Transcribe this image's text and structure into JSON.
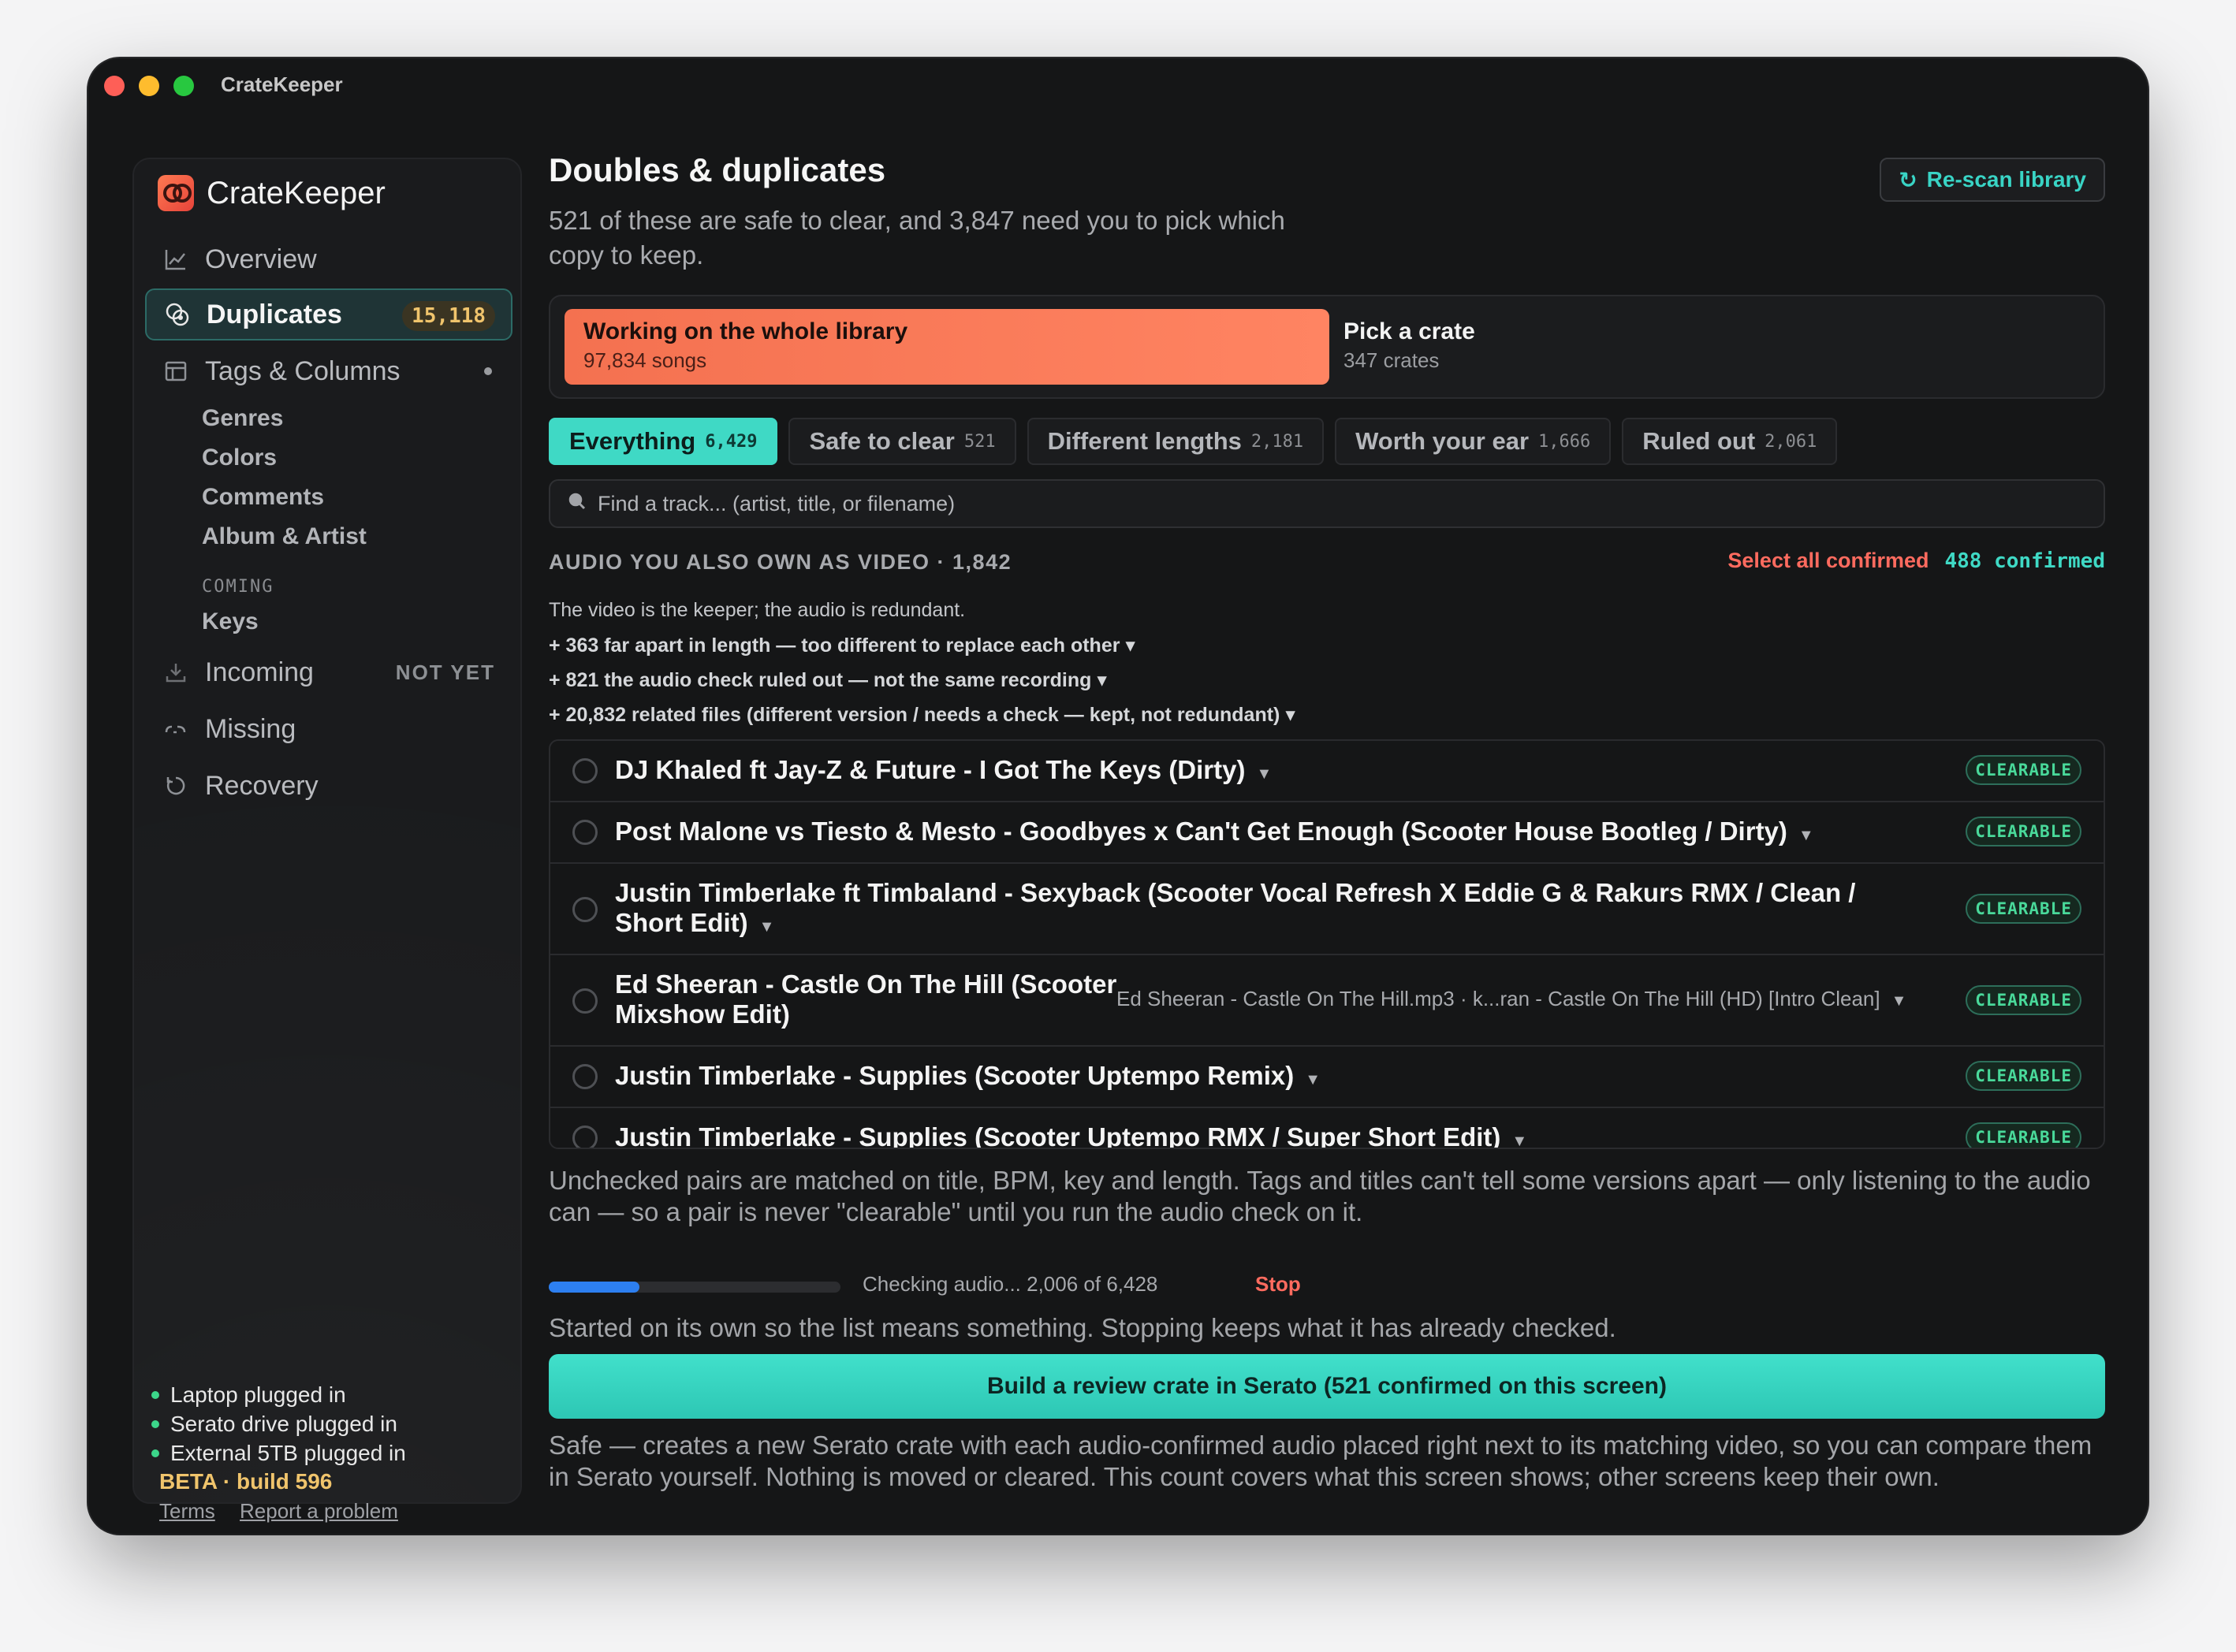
{
  "window": {
    "title": "CrateKeeper"
  },
  "sidebar": {
    "brand": "CrateKeeper",
    "items": [
      {
        "label": "Overview",
        "icon": "chart-icon"
      },
      {
        "label": "Duplicates",
        "icon": "duplicates-icon",
        "badge": "15,118",
        "active": true
      },
      {
        "label": "Tags & Columns",
        "icon": "table-icon"
      },
      {
        "label": "Incoming",
        "icon": "download-icon",
        "note": "NOT YET"
      },
      {
        "label": "Missing",
        "icon": "link-broken-icon"
      },
      {
        "label": "Recovery",
        "icon": "undo-icon"
      }
    ],
    "sub_items": [
      "Genres",
      "Colors",
      "Comments",
      "Album & Artist"
    ],
    "coming_label": "COMING",
    "coming_item": "Keys",
    "status": [
      "Laptop plugged in",
      "Serato drive plugged in",
      "External 5TB plugged in"
    ],
    "beta": "BETA · build 596",
    "links": [
      "Terms",
      "Report a problem"
    ]
  },
  "main": {
    "title": "Doubles & duplicates",
    "subtitle": "521 of these are safe to clear, and 3,847 need you to pick which copy to keep.",
    "rescan_label": "Re-scan library",
    "scope": {
      "whole_title": "Working on the whole library",
      "whole_sub": "97,834 songs",
      "crate_title": "Pick a crate",
      "crate_sub": "347 crates"
    },
    "tabs": [
      {
        "label": "Everything",
        "count": "6,429",
        "active": true
      },
      {
        "label": "Safe to clear",
        "count": "521"
      },
      {
        "label": "Different lengths",
        "count": "2,181"
      },
      {
        "label": "Worth your ear",
        "count": "1,666"
      },
      {
        "label": "Ruled out",
        "count": "2,061"
      }
    ],
    "search_placeholder": "Find a track... (artist, title, or filename)",
    "section": {
      "title": "AUDIO YOU ALSO OWN AS VIDEO · 1,842",
      "select_all": "Select all confirmed",
      "confirmed": "488 confirmed",
      "note": "The video is the keeper; the audio is redundant.",
      "expanders": [
        "+ 363 far apart in length — too different to replace each other",
        "+ 821 the audio check ruled out — not the same recording",
        "+ 20,832 related files (different version / needs a check — kept, not redundant)"
      ]
    },
    "rows": [
      {
        "title": "DJ Khaled ft Jay-Z & Future - I Got The Keys (Dirty)",
        "badge": "CLEARABLE"
      },
      {
        "title": "Post Malone vs Tiesto & Mesto - Goodbyes x Can't Get Enough (Scooter House Bootleg / Dirty)",
        "badge": "CLEARABLE"
      },
      {
        "title": "Justin Timberlake ft Timbaland - Sexyback (Scooter Vocal Refresh X Eddie G & Rakurs RMX / Clean / Short Edit)",
        "badge": "CLEARABLE"
      },
      {
        "title": "Ed Sheeran - Castle On The Hill (Scooter Mixshow Edit)",
        "files": "Ed Sheeran - Castle On The Hill.mp3  ·  k...ran - Castle On The Hill (HD) [Intro Clean]",
        "badge": "CLEARABLE"
      },
      {
        "title": "Justin Timberlake - Supplies (Scooter Uptempo Remix)",
        "badge": "CLEARABLE"
      },
      {
        "title": "Justin Timberlake - Supplies (Scooter Uptempo RMX / Super Short Edit)",
        "badge": "CLEARABLE"
      }
    ],
    "explain": "Unchecked pairs are matched on title, BPM, key and length. Tags and titles can't tell some versions apart — only listening to the audio can — so a pair is never \"clearable\" until you run the audio check on it.",
    "progress": {
      "text": "Checking audio... 2,006 of 6,428",
      "stop": "Stop",
      "fraction": 0.312
    },
    "started": "Started on its own so the list means something. Stopping keeps what it has already checked.",
    "cta": "Build a review crate in Serato (521 confirmed on this screen)",
    "footer": "Safe — creates a new Serato crate with each audio-confirmed audio placed right next to its matching video, so you can compare them in Serato yourself. Nothing is moved or cleared. This count covers what this screen shows; other screens keep their own."
  },
  "colors": {
    "accent": "#3fd9c5",
    "brand": "#f47150",
    "warning": "#ff6b5f",
    "badge": "#49d99a"
  }
}
